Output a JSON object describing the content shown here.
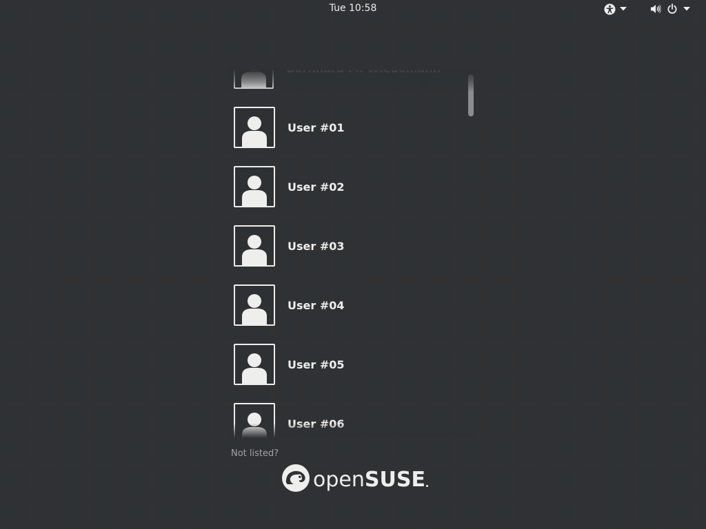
{
  "topbar": {
    "clock": "Tue 10:58",
    "accessibility_icon": "accessibility-icon",
    "volume_icon": "volume-icon",
    "power_icon": "power-icon",
    "dropdown_icon": "chevron-down-icon"
  },
  "users": [
    {
      "name": "Bernhard M. Wiedemann",
      "partial": true
    },
    {
      "name": "User #01"
    },
    {
      "name": "User #02"
    },
    {
      "name": "User #03"
    },
    {
      "name": "User #04"
    },
    {
      "name": "User #05"
    },
    {
      "name": "User #06"
    }
  ],
  "login": {
    "not_listed": "Not listed?"
  },
  "branding": {
    "logo_open": "open",
    "logo_suse": "SUSE",
    "logo_icon": "opensuse-chameleon-icon"
  },
  "colors": {
    "background": "#2e3133",
    "foreground": "#eeeeec",
    "muted_text": "#a0a2a3",
    "scrollbar": "#8a8c8e"
  }
}
